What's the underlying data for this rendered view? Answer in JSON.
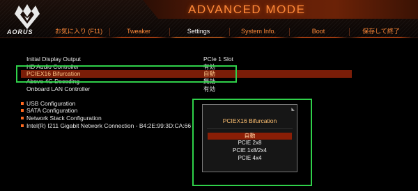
{
  "header": {
    "title": "ADVANCED MODE",
    "brand": "AORUS",
    "tabs": [
      {
        "label": "お気に入り (F11)"
      },
      {
        "label": "Tweaker"
      },
      {
        "label": "Settings"
      },
      {
        "label": "System Info."
      },
      {
        "label": "Boot"
      },
      {
        "label": "保存して終了"
      }
    ],
    "active_tab": "Settings"
  },
  "settings": [
    {
      "label": "Initial Display Output",
      "value": "PCIe 1 Slot"
    },
    {
      "label": "HD Audio Controller",
      "value": "有効"
    },
    {
      "label": "PCIEX16 Bifurcation",
      "value": "自動"
    },
    {
      "label": "Above 4G Decoding",
      "value": "無効"
    },
    {
      "label": "Onboard LAN Controller",
      "value": "有効"
    }
  ],
  "submenus": [
    {
      "label": "USB Configuration"
    },
    {
      "label": "SATA Configuration"
    },
    {
      "label": "Network Stack Configuration"
    },
    {
      "label": "Intel(R) I211 Gigabit  Network Connection - B4:2E:99:3D:CA:66"
    }
  ],
  "popup": {
    "title": "PCIEX16 Bifurcation",
    "options": [
      {
        "label": "自動"
      },
      {
        "label": "PCIE 2x8"
      },
      {
        "label": "PCIE 1x8/2x4"
      },
      {
        "label": "PCIE 4x4"
      }
    ],
    "selected": "自動"
  },
  "colors": {
    "accent": "#ff8a3a",
    "selection": "#7a1d08",
    "annotation": "#2fd14a",
    "background": "#000000"
  }
}
